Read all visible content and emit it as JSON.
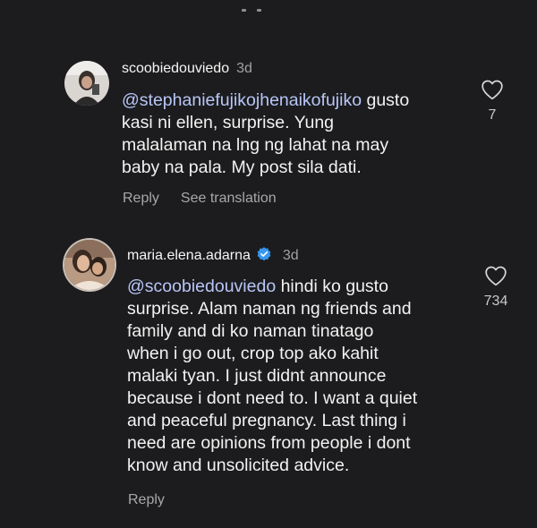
{
  "comments": [
    {
      "username": "scoobiedouviedo",
      "time": "3d",
      "mention": "@stephaniefujikojhenaikofujiko",
      "text_lines": [
        " gusto",
        "kasi ni ellen, surprise. Yung",
        "malalaman na lng ng lahat na may",
        "baby na pala.  My post sila dati."
      ],
      "reply_label": "Reply",
      "translate_label": "See translation",
      "likes": "7",
      "verified": false
    },
    {
      "username": "maria.elena.adarna",
      "time": "3d",
      "mention": "@scoobiedouviedo",
      "text_lines": [
        " hindi ko gusto",
        "surprise. Alam naman ng friends and",
        "family and di ko naman tinatago",
        "when i go out, crop top ako kahit",
        "malaki tyan. I just didnt announce",
        "because i dont need to. I want a quiet",
        "and peaceful pregnancy. Last thing i",
        "need are opinions from people i dont",
        "know and unsolicited advice."
      ],
      "reply_label": "Reply",
      "likes": "734",
      "verified": true
    }
  ],
  "colors": {
    "background": "#1c1c1e",
    "mention": "#b8c6f7",
    "verified": "#3897f0",
    "muted": "#a8a8a8"
  }
}
